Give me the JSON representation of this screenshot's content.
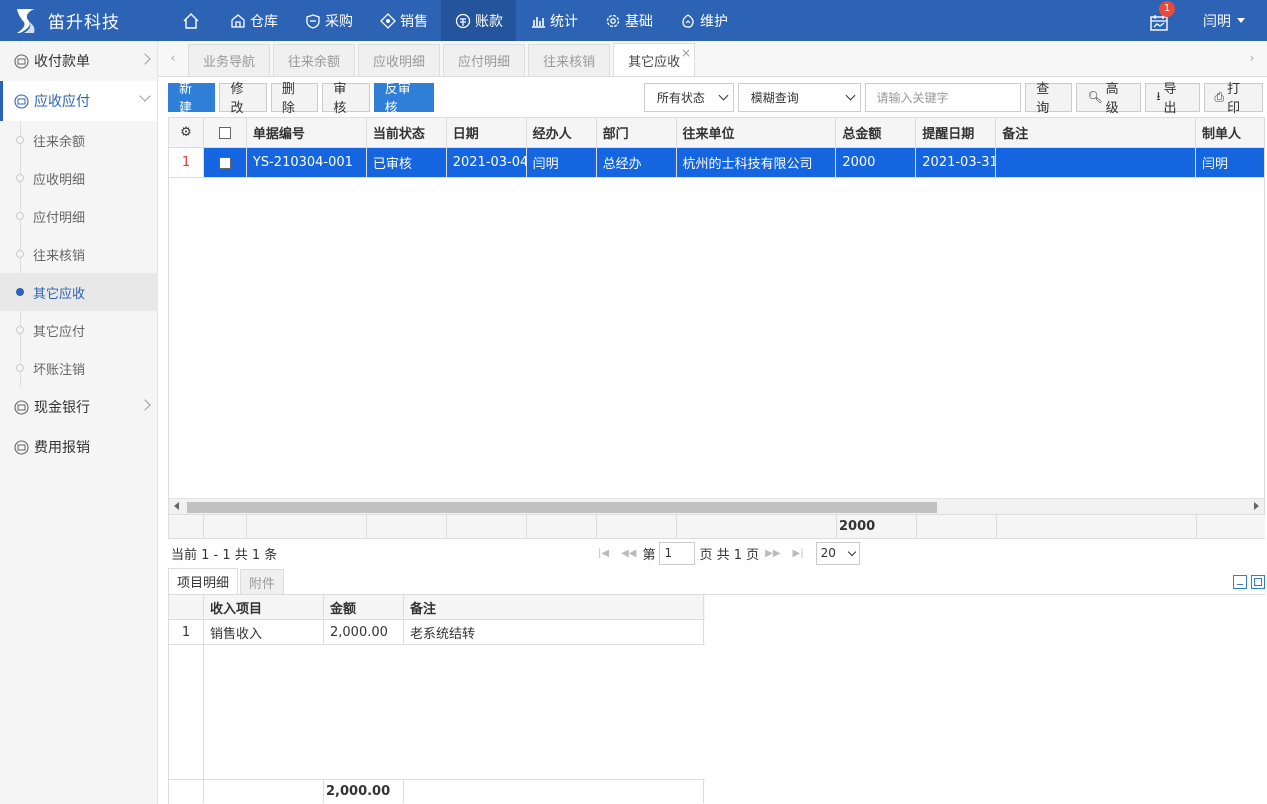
{
  "app": {
    "brand": "笛升科技"
  },
  "nav": {
    "items": [
      {
        "label": "仓库",
        "icon": "warehouse-icon"
      },
      {
        "label": "采购",
        "icon": "purchase-icon"
      },
      {
        "label": "销售",
        "icon": "sales-icon"
      },
      {
        "label": "账款",
        "icon": "accounts-icon",
        "active": true
      },
      {
        "label": "统计",
        "icon": "chart-icon"
      },
      {
        "label": "基础",
        "icon": "gear-icon"
      },
      {
        "label": "维护",
        "icon": "maintenance-icon"
      }
    ],
    "notifications": "1",
    "user": "闫明"
  },
  "sidebar": {
    "groups": [
      {
        "label": "收付款单"
      },
      {
        "label": "应收应付"
      },
      {
        "label": "现金银行"
      },
      {
        "label": "费用报销"
      }
    ],
    "subitems": [
      {
        "label": "往来余额"
      },
      {
        "label": "应收明细"
      },
      {
        "label": "应付明细"
      },
      {
        "label": "往来核销"
      },
      {
        "label": "其它应收"
      },
      {
        "label": "其它应付"
      },
      {
        "label": "坏账注销"
      }
    ]
  },
  "tabs": [
    "业务导航",
    "往来余额",
    "应收明细",
    "应付明细",
    "往来核销",
    "其它应收"
  ],
  "toolbar": {
    "new": "新建",
    "edit": "修改",
    "delete": "删除",
    "audit": "审核",
    "unaudit": "反审核",
    "status_select": "所有状态",
    "query_mode": "模糊查询",
    "keyword_placeholder": "请输入关键字",
    "query": "查询",
    "advanced": "高级",
    "export": "导出",
    "print": "打印"
  },
  "grid": {
    "columns": [
      "单据编号",
      "当前状态",
      "日期",
      "经办人",
      "部门",
      "往来单位",
      "总金额",
      "提醒日期",
      "备注",
      "制单人"
    ],
    "rows": [
      {
        "num": "1",
        "doc_no": "YS-210304-001",
        "status": "已审核",
        "date": "2021-03-04",
        "handler": "闫明",
        "dept": "总经办",
        "partner": "杭州的士科技有限公司",
        "amount": "2000",
        "remind_date": "2021-03-31",
        "note": "",
        "creator": "闫明"
      }
    ],
    "total_amount": "2000"
  },
  "pager": {
    "info": "当前 1 - 1 共 1 条",
    "page_prefix": "第",
    "page": "1",
    "page_suffix": "页 共 1 页",
    "page_size": "20"
  },
  "detail": {
    "tabs": [
      "项目明细",
      "附件"
    ],
    "columns": [
      "收入项目",
      "金额",
      "备注"
    ],
    "rows": [
      {
        "num": "1",
        "item": "销售收入",
        "amount": "2,000.00",
        "note": "老系统结转"
      }
    ],
    "total_amount": "2,000.00"
  }
}
